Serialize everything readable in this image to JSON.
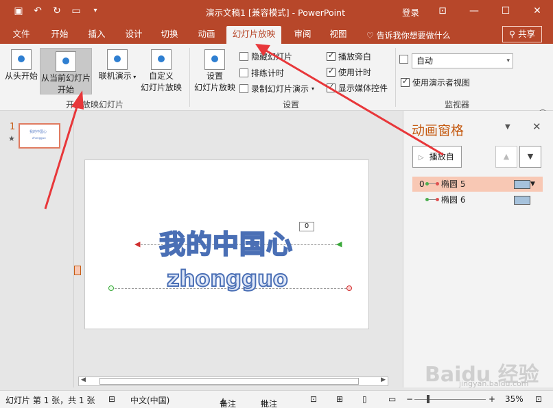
{
  "window": {
    "title": "演示文稿1 [兼容模式] - PowerPoint",
    "login": "登录",
    "qat": [
      "save-icon",
      "undo-icon",
      "redo-icon",
      "present-icon",
      "customize-icon"
    ]
  },
  "tabs": [
    {
      "label": "文件"
    },
    {
      "label": "开始"
    },
    {
      "label": "插入"
    },
    {
      "label": "设计"
    },
    {
      "label": "切换"
    },
    {
      "label": "动画"
    },
    {
      "label": "幻灯片放映",
      "active": true
    },
    {
      "label": "审阅"
    },
    {
      "label": "视图"
    }
  ],
  "tellme": "告诉我你想要做什么",
  "share": "共享",
  "ribbon": {
    "from_start": "从头开始",
    "from_current_l1": "从当前幻灯片",
    "from_current_l2": "开始",
    "online_present": "联机演示",
    "custom_l1": "自定义",
    "custom_l2": "幻灯片放映",
    "group_start": "开始放映幻灯片",
    "setup_l1": "设置",
    "setup_l2": "幻灯片放映",
    "hide_slide": "隐藏幻灯片",
    "rehearse": "排练计时",
    "record": "录制幻灯片演示",
    "play_narration": "播放旁白",
    "use_timing": "使用计时",
    "show_media": "显示媒体控件",
    "group_setup": "设置",
    "monitor_value": "自动",
    "presenter_view": "使用演示者视图",
    "group_monitor": "监视器"
  },
  "thumbnails": [
    {
      "number": "1",
      "star": "★",
      "line1": "我的中国心",
      "line2": "zhongguo"
    }
  ],
  "slide": {
    "title": "我的中国心",
    "subtitle": "zhongguo",
    "anim_badge": "0"
  },
  "pane": {
    "title": "动画窗格",
    "play_label": "播放自",
    "items": [
      {
        "index": "0",
        "name": "椭圆 5",
        "selected": true
      },
      {
        "index": "",
        "name": "椭圆 6",
        "selected": false
      }
    ]
  },
  "status": {
    "slide_info": "幻灯片 第 1 张，共 1 张",
    "language": "中文(中国)",
    "notes": "备注",
    "comments": "批注",
    "zoom": "35%"
  },
  "watermark": {
    "brand": "Baidu 经验",
    "url": "jingyan.baidu.com"
  },
  "colors": {
    "accent": "#b7472a",
    "selection": "#f8c8b4",
    "arrow": "#e8373a"
  }
}
